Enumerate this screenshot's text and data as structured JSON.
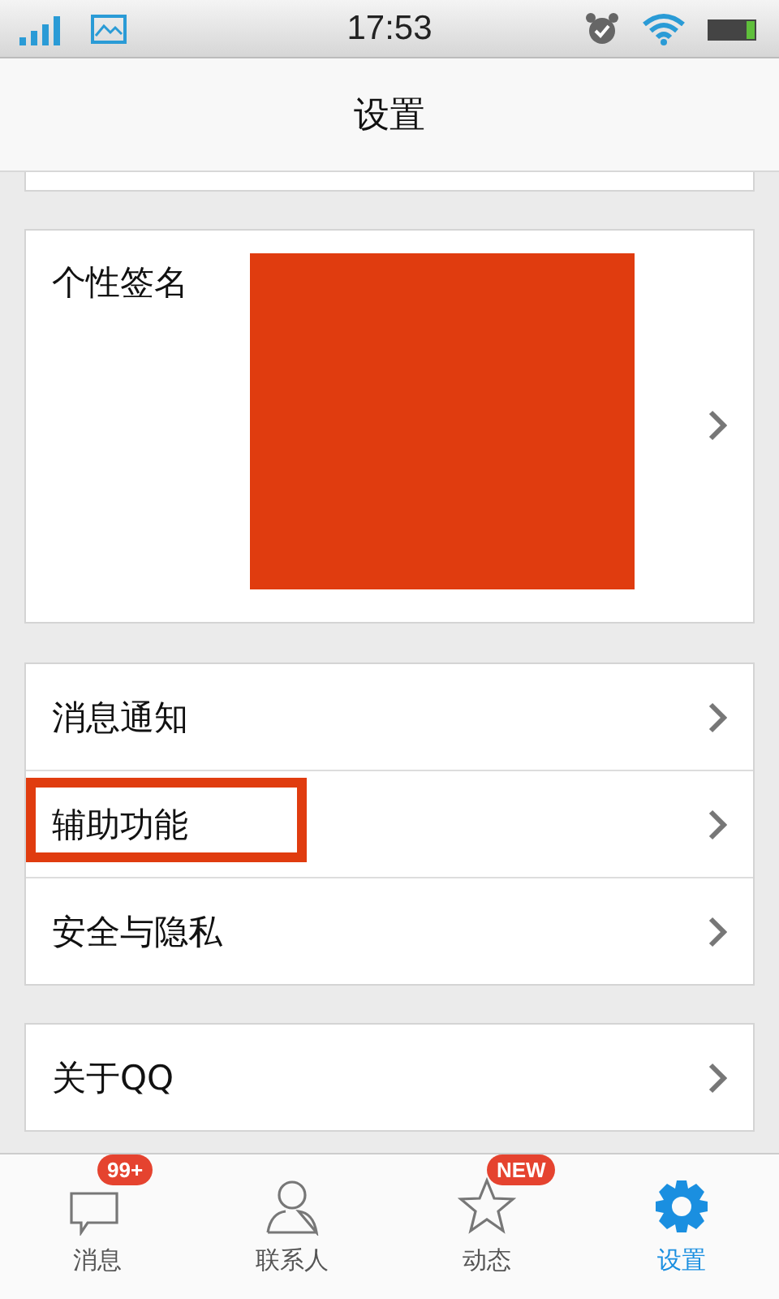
{
  "status_bar": {
    "time": "17:53"
  },
  "header": {
    "title": "设置"
  },
  "signature": {
    "label": "个性签名",
    "redacted": true
  },
  "groups": [
    [
      {
        "label": "消息通知",
        "highlighted": false
      },
      {
        "label": "辅助功能",
        "highlighted": true
      },
      {
        "label": "安全与隐私",
        "highlighted": false
      }
    ],
    [
      {
        "label": "关于QQ",
        "highlighted": false
      }
    ]
  ],
  "tabs": [
    {
      "kind": "messages",
      "label": "消息",
      "selected": false,
      "badge": "99+"
    },
    {
      "kind": "contacts",
      "label": "联系人",
      "selected": false
    },
    {
      "kind": "feed",
      "label": "动态",
      "selected": false,
      "badge": "NEW"
    },
    {
      "kind": "settings",
      "label": "设置",
      "selected": true
    }
  ]
}
